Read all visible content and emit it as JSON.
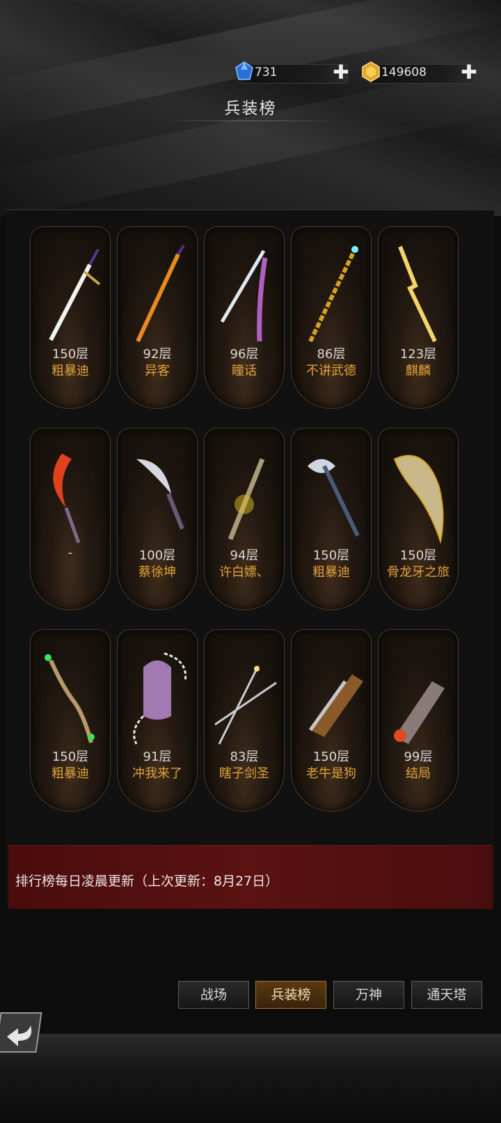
{
  "currency": {
    "gems": {
      "icon": "blue-gem-icon",
      "value": "731"
    },
    "gold": {
      "icon": "gold-coin-icon",
      "value": "149608"
    }
  },
  "page_title": "兵装榜",
  "weapons": [
    {
      "layer": "150层",
      "owner": "粗暴迪",
      "icon": "sword-icon"
    },
    {
      "layer": "92层",
      "owner": "异客",
      "icon": "flame-blade-icon"
    },
    {
      "layer": "96层",
      "owner": "瞳话",
      "icon": "katana-icon"
    },
    {
      "layer": "86层",
      "owner": "不讲武德",
      "icon": "golden-staff-icon"
    },
    {
      "layer": "123层",
      "owner": "麒麟",
      "icon": "lightning-icon"
    },
    {
      "layer": "-",
      "owner": "",
      "icon": "fire-sickle-icon"
    },
    {
      "layer": "100层",
      "owner": "蔡徐坤",
      "icon": "curved-dagger-icon"
    },
    {
      "layer": "94层",
      "owner": "许白嫖、",
      "icon": "spiked-blade-icon"
    },
    {
      "layer": "150层",
      "owner": "粗暴迪",
      "icon": "battle-axe-icon"
    },
    {
      "layer": "150层",
      "owner": "骨龙牙之旅",
      "icon": "bone-horn-icon"
    },
    {
      "layer": "150层",
      "owner": "粗暴迪",
      "icon": "branch-staff-icon"
    },
    {
      "layer": "91层",
      "owner": "冲我来了",
      "icon": "chain-gauntlet-icon"
    },
    {
      "layer": "83层",
      "owner": "瞎子剑圣",
      "icon": "twin-rapier-icon"
    },
    {
      "layer": "150层",
      "owner": "老牛是狗",
      "icon": "flintlock-pistol-icon"
    },
    {
      "layer": "99层",
      "owner": "结局",
      "icon": "hand-cannon-icon"
    }
  ],
  "notice": "排行榜每日凌晨更新（上次更新：8月27日）",
  "tabs": [
    {
      "label": "战场",
      "active": false
    },
    {
      "label": "兵装榜",
      "active": true
    },
    {
      "label": "万神",
      "active": false
    },
    {
      "label": "通天塔",
      "active": false
    }
  ],
  "back_button": {
    "icon": "back-arrow-icon"
  }
}
